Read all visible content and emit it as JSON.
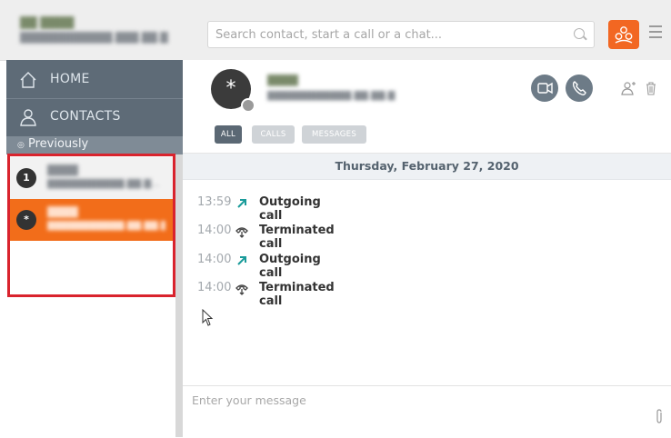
{
  "account": {
    "name": "██ ████",
    "address": "████████████.███.██.█"
  },
  "search": {
    "placeholder": "Search contact, start a call or a chat..."
  },
  "nav": {
    "home_label": "HOME",
    "contacts_label": "CONTACTS"
  },
  "sidebar": {
    "section_label": "Previously",
    "contacts": [
      {
        "avatar": "1",
        "name": "████",
        "address": "███████████.██.█..."
      },
      {
        "avatar": "*",
        "name": "████",
        "address": "███████████.██.██.█"
      }
    ]
  },
  "contact_header": {
    "avatar": "*",
    "name": "████",
    "address": "████████████.██.██.█"
  },
  "filter_tabs": {
    "all": "ALL",
    "calls": "CALLS",
    "messages": "MESSAGES"
  },
  "conversation": {
    "date": "Thursday, February 27, 2020",
    "events": [
      {
        "time": "13:59",
        "icon": "outgoing-arrow-icon",
        "label": "Outgoing call"
      },
      {
        "time": "14:00",
        "icon": "terminated-call-icon",
        "label": "Terminated call"
      },
      {
        "time": "14:00",
        "icon": "outgoing-arrow-icon",
        "label": "Outgoing call"
      },
      {
        "time": "14:00",
        "icon": "terminated-call-icon",
        "label": "Terminated call"
      }
    ]
  },
  "composer": {
    "placeholder": "Enter your message"
  },
  "colors": {
    "accent_orange": "#f26722",
    "nav_slate": "#5e6b77",
    "highlight_red": "#d9232d",
    "outgoing_teal": "#1a9b9a"
  }
}
